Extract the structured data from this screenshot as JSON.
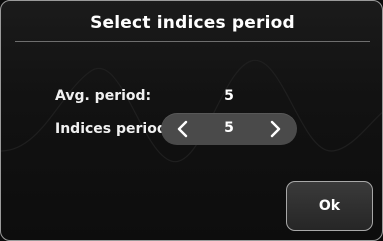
{
  "dialog": {
    "title": "Select indices period",
    "avg_period": {
      "label": "Avg. period:",
      "value": "5"
    },
    "indices_period": {
      "label": "Indices period:",
      "value": "5",
      "prev_icon": "chevron-left-icon",
      "next_icon": "chevron-right-icon"
    },
    "ok_label": "Ok"
  },
  "colors": {
    "background": "#0a0a0a",
    "border": "#9a9a9a",
    "stepper_fill": "#4a4a4a",
    "text": "#ffffff"
  }
}
